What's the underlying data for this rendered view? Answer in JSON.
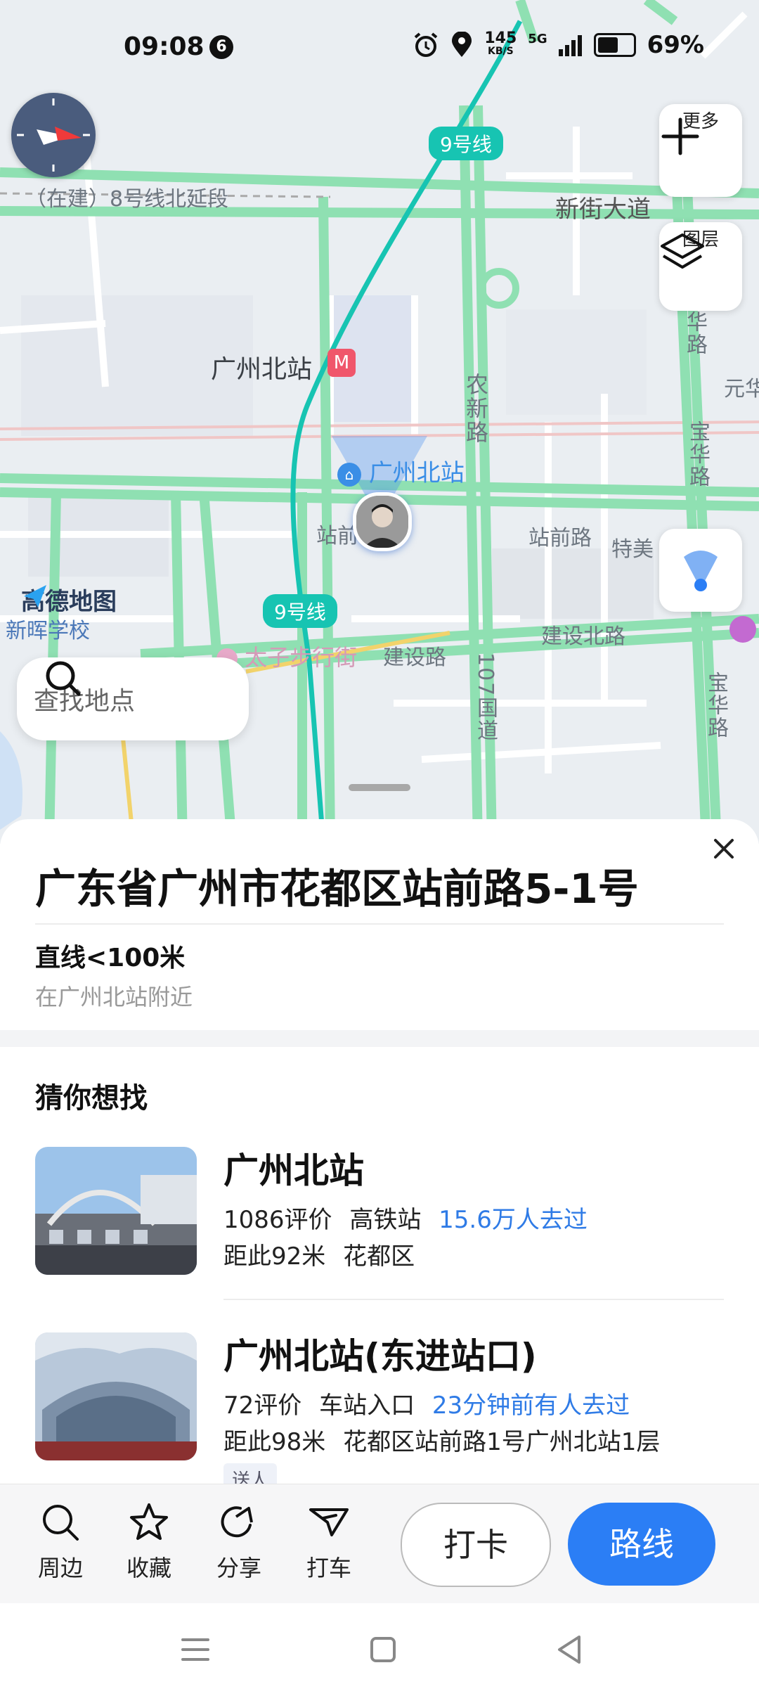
{
  "status_bar": {
    "time": "09:08",
    "notification_count": "6",
    "net_speed_value": "145",
    "net_speed_unit": "KB/S",
    "network": "5G",
    "battery": "69%"
  },
  "map": {
    "metro_line_top": "9号线",
    "metro_line_bottom": "9号线",
    "labels": {
      "construction_line": "（在建）8号线北延段",
      "xinjie_road": "新街大道",
      "station_name": "广州北站",
      "station_poi": "广州北站",
      "nongxin_road": "农新路",
      "zhanqian_road_left": "站前",
      "zhanqian_road_right": "站前路",
      "temei": "特美",
      "jianshe_north_road_left": "建设路",
      "jianshe_north_road_right": "建设北路",
      "taizi_street": "太子步行街",
      "xinhui_school": "新晖学校",
      "road_107": "107国道",
      "baohua_road_top": "宝华路",
      "baohua_road_mid": "宝华路",
      "baohua_road_bottom": "宝华路",
      "yuanhua": "元华"
    },
    "brand": "高德地图",
    "search_placeholder": "查找地点",
    "more_label": "更多",
    "layers_label": "图层"
  },
  "sheet": {
    "address": "广东省广州市花都区站前路5-1号",
    "distance": "直线<100米",
    "nearby": "在广州北站附近",
    "section_title": "猜你想找",
    "results": [
      {
        "title": "广州北站",
        "reviews": "1086评价",
        "category": "高铁站",
        "visits": "15.6万人去过",
        "distance": "距此92米",
        "area": "花都区"
      },
      {
        "title": "广州北站(东进站口)",
        "reviews": "72评价",
        "category": "车站入口",
        "visits": "23分钟前有人去过",
        "distance": "距此98米",
        "area": "花都区站前路1号广州北站1层",
        "tag": "送人"
      }
    ]
  },
  "actions": {
    "nearby": "周边",
    "favorite": "收藏",
    "share": "分享",
    "taxi": "打车",
    "checkin": "打卡",
    "route": "路线"
  },
  "colors": {
    "accent": "#2b7ef5",
    "metro": "#17c4b2",
    "road": "#8fe0b2",
    "highlight_text": "#2f7be6"
  }
}
